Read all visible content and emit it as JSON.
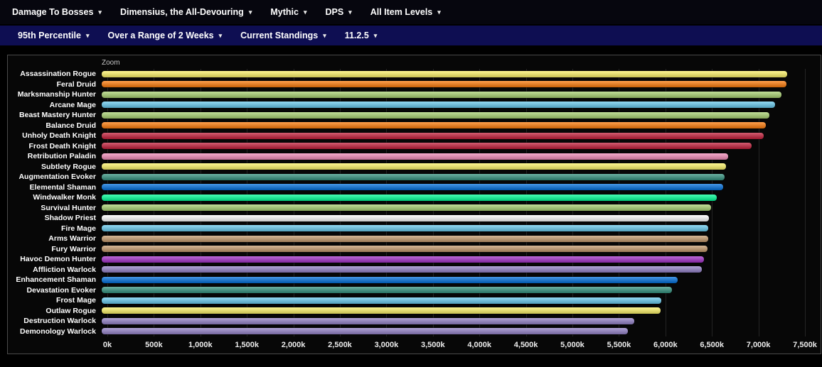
{
  "toolbar_primary": {
    "items": [
      "Damage To Bosses",
      "Dimensius, the All-Devouring",
      "Mythic",
      "DPS",
      "All Item Levels"
    ]
  },
  "toolbar_secondary": {
    "items": [
      "95th Percentile",
      "Over a Range of 2 Weeks",
      "Current Standings",
      "11.2.5"
    ]
  },
  "chart": {
    "zoom_label": "Zoom"
  },
  "chart_data": {
    "type": "bar",
    "orientation": "horizontal",
    "title": "",
    "xlabel": "",
    "ylabel": "",
    "unit": "k (thousands of DPS)",
    "xlim": [
      0,
      7500
    ],
    "grid": true,
    "x_ticks": [
      "0k",
      "500k",
      "1,000k",
      "1,500k",
      "2,000k",
      "2,500k",
      "3,000k",
      "3,500k",
      "4,000k",
      "4,500k",
      "5,000k",
      "5,500k",
      "6,000k",
      "6,500k",
      "7,000k",
      "7,500k"
    ],
    "categories": [
      "Assassination Rogue",
      "Feral Druid",
      "Marksmanship Hunter",
      "Arcane Mage",
      "Beast Mastery Hunter",
      "Balance Druid",
      "Unholy Death Knight",
      "Frost Death Knight",
      "Retribution Paladin",
      "Subtlety Rogue",
      "Augmentation Evoker",
      "Elemental Shaman",
      "Windwalker Monk",
      "Survival Hunter",
      "Shadow Priest",
      "Fire Mage",
      "Arms Warrior",
      "Fury Warrior",
      "Havoc Demon Hunter",
      "Affliction Warlock",
      "Enhancement Shaman",
      "Devastation Evoker",
      "Frost Mage",
      "Outlaw Rogue",
      "Destruction Warlock",
      "Demonology Warlock"
    ],
    "values": [
      7310,
      7300,
      7250,
      7180,
      7120,
      7080,
      7060,
      6930,
      6680,
      6660,
      6640,
      6630,
      6560,
      6500,
      6480,
      6470,
      6465,
      6460,
      6420,
      6400,
      6140,
      6080,
      5970,
      5960,
      5680,
      5610
    ],
    "colors": [
      "#FFF569",
      "#FF7C0A",
      "#AAD372",
      "#69CCF0",
      "#AAD372",
      "#FF7C0A",
      "#C41E3A",
      "#C41E3A",
      "#F48CBA",
      "#FFF569",
      "#33937F",
      "#0070DD",
      "#00FF98",
      "#AAD372",
      "#FFFFFF",
      "#69CCF0",
      "#C69B6D",
      "#C69B6D",
      "#A330C9",
      "#9482C9",
      "#0070DD",
      "#33937F",
      "#69CCF0",
      "#FFF569",
      "#9482C9",
      "#9482C9"
    ]
  }
}
